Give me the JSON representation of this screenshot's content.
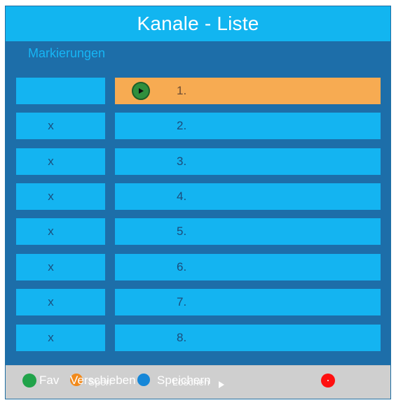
{
  "title": "Kanale - Liste",
  "section_label": "Markierungen",
  "rows": [
    {
      "mark": "",
      "channel": "1.",
      "selected": true
    },
    {
      "mark": "x",
      "channel": "2.",
      "selected": false
    },
    {
      "mark": "x",
      "channel": "3.",
      "selected": false
    },
    {
      "mark": "x",
      "channel": "4.",
      "selected": false
    },
    {
      "mark": "x",
      "channel": "5.",
      "selected": false
    },
    {
      "mark": "x",
      "channel": "6.",
      "selected": false
    },
    {
      "mark": "x",
      "channel": "7.",
      "selected": false
    },
    {
      "mark": "x",
      "channel": "8.",
      "selected": false
    }
  ],
  "footer": {
    "green_label": "Fav",
    "orange_label_a": "Verschieben",
    "orange_label_b": "Sperr",
    "blue_label_a": "Speichern",
    "blue_label_b": "Löschen",
    "green_color": "#21a34a",
    "orange_color": "#f28a1b",
    "blue_color": "#1687d8",
    "red_color": "#ff0f0f"
  },
  "icons": {
    "play": "play-icon",
    "side_arrow": "right-arrow-icon",
    "footer_next": "right-arrow-icon",
    "red_button": "red-dot-icon"
  }
}
